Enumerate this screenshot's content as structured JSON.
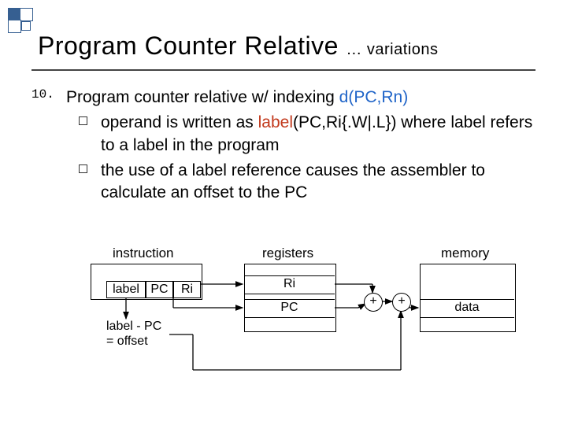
{
  "title": {
    "main": "Program Counter Relative",
    "suffix": "… variations"
  },
  "numbered": "10.",
  "maintext": {
    "lead": "Program counter relative w/ indexing  ",
    "dpcrn": "d(PC,Rn)"
  },
  "bullets": {
    "b1a": "operand is written as  ",
    "b1_label": "label",
    "b1b": "(PC,Ri{.W|.L}) where label refers to a label in the program",
    "b2": "the use of a label reference causes the assembler to calculate an offset to the PC"
  },
  "diagram": {
    "instruction": "instruction",
    "registers": "registers",
    "memory": "memory",
    "cells": {
      "label": "label",
      "pc": "PC",
      "ri": "Ri"
    },
    "reg_ri": "Ri",
    "reg_pc": "PC",
    "mem_data": "data",
    "offset": "label - PC\n= offset",
    "plus": "+"
  }
}
